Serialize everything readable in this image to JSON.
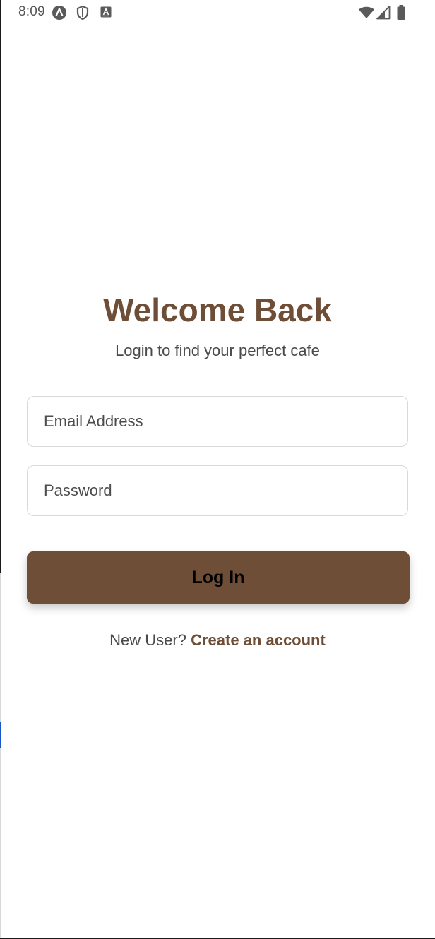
{
  "status_bar": {
    "time": "8:09",
    "left_icons": [
      "circle-a-icon",
      "shield-icon",
      "square-a-icon"
    ],
    "right_icons": [
      "wifi-icon",
      "signal-icon",
      "battery-icon"
    ]
  },
  "login": {
    "title": "Welcome Back",
    "subtitle": "Login to find your perfect cafe",
    "email_placeholder": "Email Address",
    "email_value": "",
    "password_placeholder": "Password",
    "password_value": "",
    "login_button_label": "Log In",
    "signup_prompt": "New User?",
    "signup_link": "Create an account"
  },
  "colors": {
    "brand": "#6f4e37",
    "text": "#4a4a4a",
    "border": "#d9d9d9",
    "background": "#ffffff"
  }
}
